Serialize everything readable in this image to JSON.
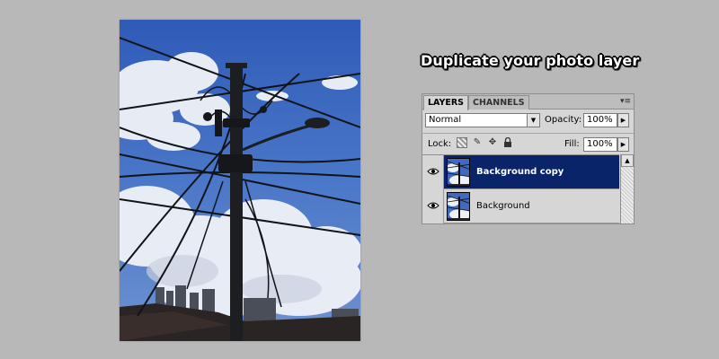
{
  "title": "Duplicate your photo layer",
  "panel": {
    "tabs": [
      {
        "label": "LAYERS",
        "active": true
      },
      {
        "label": "CHANNELS",
        "active": false
      }
    ],
    "blend_mode": "Normal",
    "opacity_label": "Opacity:",
    "opacity_value": "100%",
    "lock_label": "Lock:",
    "fill_label": "Fill:",
    "fill_value": "100%",
    "layers": [
      {
        "name": "Background copy",
        "selected": true,
        "visible": true
      },
      {
        "name": "Background",
        "selected": false,
        "visible": true
      }
    ]
  },
  "icons": {
    "eye": "eye-icon",
    "lock_transparent": "lock-transparent-icon",
    "lock_image": "brush-icon",
    "lock_position": "move-icon",
    "lock_all": "lock-icon",
    "panel_menu": "panel-menu-icon"
  },
  "colors": {
    "background": "#b9b8b9",
    "selection": "#0a246a",
    "panel": "#d6d6d6",
    "sky": "#3f6ac0"
  }
}
